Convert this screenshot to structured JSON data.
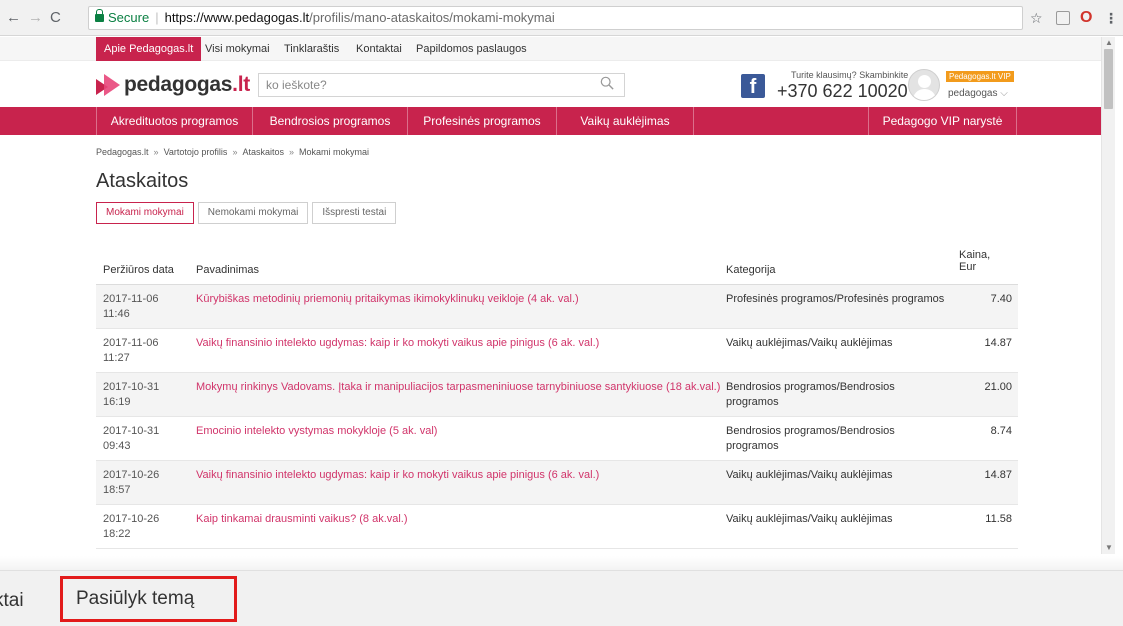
{
  "browser": {
    "secure_label": "Secure",
    "url_host": "https://www.pedagogas.lt",
    "url_path": "/profilis/mano-ataskaitos/mokami-mokymai"
  },
  "topbar": {
    "items": [
      "Apie Pedagogas.lt",
      "Visi mokymai",
      "Tinklaraštis",
      "Kontaktai",
      "Papildomos paslaugos"
    ]
  },
  "header": {
    "logo_main": "pedagogas",
    "logo_tld": ".lt",
    "search_placeholder": "ko ieškote?",
    "contact_note": "Turite klausimų? Skambinkite",
    "contact_phone": "+370 622 10020",
    "vip_badge": "Pedagogas.lt VIP",
    "user_name": "pedagogas"
  },
  "mainnav": {
    "items": [
      "Akredituotos programos",
      "Bendrosios programos",
      "Profesinės programos",
      "Vaikų auklėjimas",
      "Pedagogo VIP narystė"
    ]
  },
  "breadcrumb": [
    "Pedagogas.lt",
    "Vartotojo profilis",
    "Ataskaitos",
    "Mokami mokymai"
  ],
  "breadcrumb_separator": "»",
  "page_title": "Ataskaitos",
  "tabs": [
    "Mokami mokymai",
    "Nemokami mokymai",
    "Išspresti testai"
  ],
  "table": {
    "headers": {
      "date": "Peržiūros data",
      "name": "Pavadinimas",
      "category": "Kategorija",
      "price_1": "Kaina,",
      "price_2": "Eur"
    },
    "rows": [
      {
        "date": "2017-11-06",
        "time": "11:46",
        "name": "Kūrybiškas metodinių priemonių pritaikymas ikimokyklinukų veikloje (4 ak. val.)",
        "category": "Profesinės programos/Profesinės programos",
        "price": "7.40"
      },
      {
        "date": "2017-11-06",
        "time": "11:27",
        "name": "Vaikų finansinio intelekto ugdymas: kaip ir ko mokyti vaikus apie pinigus (6 ak. val.)",
        "category": "Vaikų auklėjimas/Vaikų auklėjimas",
        "price": "14.87"
      },
      {
        "date": "2017-10-31",
        "time": "16:19",
        "name": "Mokymų rinkinys Vadovams. Įtaka ir manipuliacijos tarpasmeniniuose tarnybiniuose santykiuose (18 ak.val.)",
        "category": "Bendrosios programos/Bendrosios programos",
        "price": "21.00"
      },
      {
        "date": "2017-10-31",
        "time": "09:43",
        "name": "Emocinio intelekto vystymas mokykloje (5 ak. val)",
        "category": "Bendrosios programos/Bendrosios programos",
        "price": "8.74"
      },
      {
        "date": "2017-10-26",
        "time": "18:57",
        "name": "Vaikų finansinio intelekto ugdymas: kaip ir ko mokyti vaikus apie pinigus (6 ak. val.)",
        "category": "Vaikų auklėjimas/Vaikų auklėjimas",
        "price": "14.87"
      },
      {
        "date": "2017-10-26",
        "time": "18:22",
        "name": "Kaip tinkamai drausminti vaikus? (8 ak.val.)",
        "category": "Vaikų auklėjimas/Vaikų auklėjimas",
        "price": "11.58"
      }
    ]
  },
  "bottom": {
    "prev_fragment": "ktai",
    "suggest_topic": "Pasiūlyk temą"
  },
  "colors": {
    "brand": "#c8234d",
    "link": "#d1346a",
    "vip": "#f29b1c",
    "facebook": "#3b5998",
    "highlight": "#e21b1b"
  },
  "icons": [
    "back-icon",
    "forward-icon",
    "reload-icon",
    "lock-icon",
    "star-icon",
    "extension-icon",
    "opera-icon",
    "menu-icon",
    "search-icon",
    "facebook-icon",
    "avatar",
    "chevron-down-icon"
  ]
}
